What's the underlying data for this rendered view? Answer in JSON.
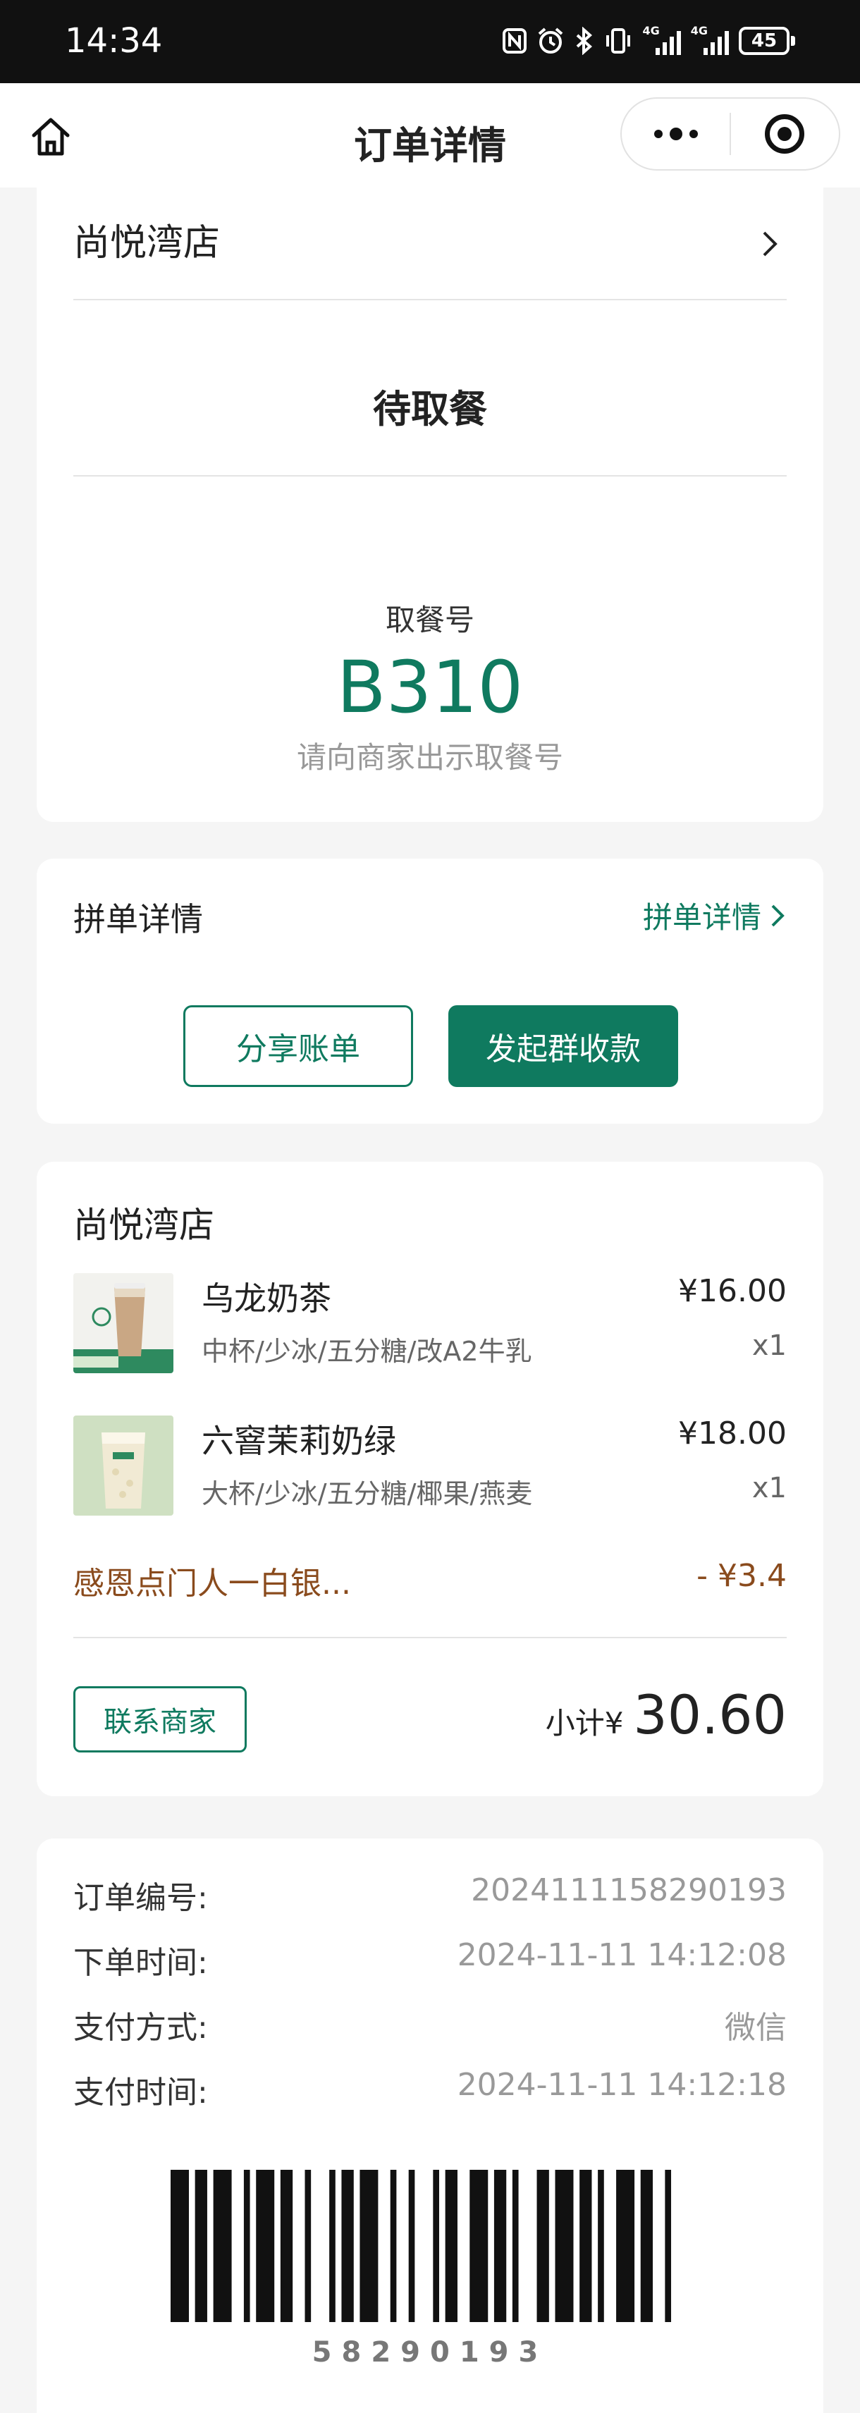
{
  "status_bar": {
    "time": "14:34",
    "network_label": "4G",
    "network_label_2": "4G",
    "battery": "45",
    "icons": [
      "nfc-icon",
      "alarm-icon",
      "bluetooth-icon",
      "vibrate-icon",
      "signal-icon",
      "signal-icon",
      "battery-icon"
    ]
  },
  "navbar": {
    "title": "订单详情",
    "icons": [
      "home-icon",
      "more-icon",
      "target-icon"
    ]
  },
  "store": {
    "name": "尚悦湾店",
    "status": "待取餐",
    "pickup_label": "取餐号",
    "pickup_number": "B310",
    "pickup_hint": "请向商家出示取餐号"
  },
  "split": {
    "title": "拼单详情",
    "link": "拼单详情",
    "share_button": "分享账单",
    "collect_button": "发起群收款"
  },
  "order": {
    "store_name": "尚悦湾店",
    "items": [
      {
        "name": "乌龙奶茶",
        "options": "中杯/少冰/五分糖/改A2牛乳",
        "price": "¥16.00",
        "qty": "x1"
      },
      {
        "name": "六窨茉莉奶绿",
        "options": "大杯/少冰/五分糖/椰果/燕麦",
        "price": "¥18.00",
        "qty": "x1"
      }
    ],
    "promo_name": "感恩点门人一白银...",
    "promo_value": "- ¥3.4",
    "contact_button": "联系商家",
    "subtotal_label": "小计¥",
    "subtotal_value": "30.60"
  },
  "info": {
    "rows": [
      {
        "label": "订单编号:",
        "value": "2024111158290193"
      },
      {
        "label": "下单时间:",
        "value": "2024-11-11 14:12:08"
      },
      {
        "label": "支付方式:",
        "value": "微信"
      },
      {
        "label": "支付时间:",
        "value": "2024-11-11 14:12:18"
      }
    ],
    "barcode_number": "58290193"
  },
  "colors": {
    "brand_green": "#0f7a5f",
    "promo_brown": "#8a4b1d",
    "background": "#f5f5f5"
  }
}
